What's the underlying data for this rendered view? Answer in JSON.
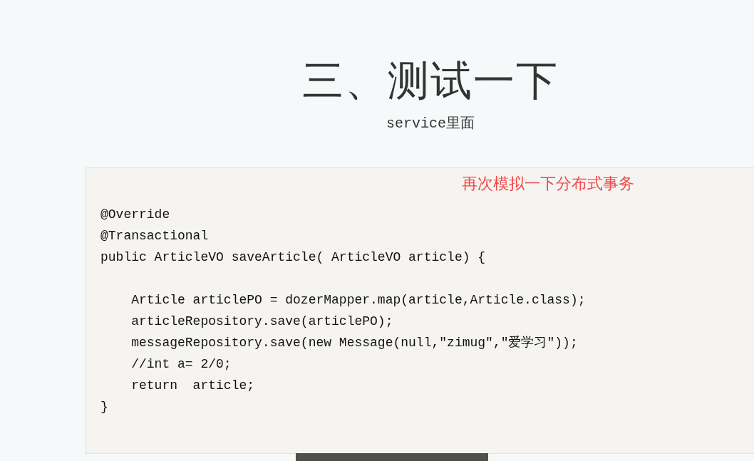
{
  "heading": {
    "title": "三、测试一下",
    "subtitle": "service里面"
  },
  "code": {
    "annotation": "再次模拟一下分布式事务",
    "blocks": [
      [
        "@Override",
        "@Transactional",
        "public ArticleVO saveArticle( ArticleVO article) {"
      ],
      [
        "    Article articlePO = dozerMapper.map(article,Article.class);",
        "    articleRepository.save(articlePO);",
        "    messageRepository.save(new Message(null,\"zimug\",\"爱学习\"));",
        "    //int a= 2/0;",
        "    return  article;",
        "}"
      ]
    ]
  }
}
